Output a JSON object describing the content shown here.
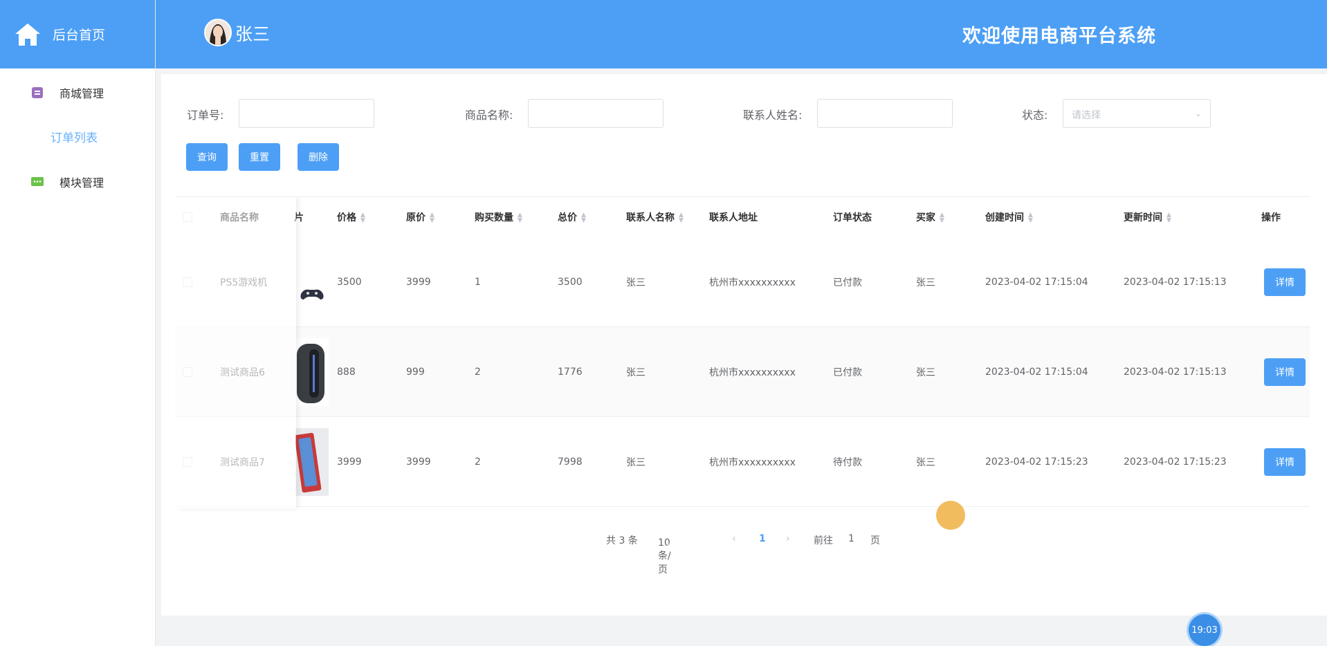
{
  "sidebar": {
    "brand_label": "后台首页",
    "groups": [
      {
        "label": "商城管理",
        "icon": "store-icon",
        "color": "#9b6fbf"
      },
      {
        "label": "模块管理",
        "icon": "message-icon",
        "color": "#6cc24a"
      }
    ],
    "submenu": [
      {
        "label": "订单列表"
      }
    ]
  },
  "header": {
    "username": "张三",
    "welcome": "欢迎使用电商平台系统"
  },
  "search": {
    "order_no_label": "订单号:",
    "product_name_label": "商品名称:",
    "contact_name_label": "联系人姓名:",
    "status_label": "状态:",
    "status_placeholder": "请选择"
  },
  "buttons": {
    "query": "查询",
    "reset": "重置",
    "delete": "删除",
    "detail": "详情"
  },
  "table": {
    "columns": {
      "name": "商品名称",
      "pic": "片",
      "price": "价格",
      "orig_price": "原价",
      "qty": "购买数量",
      "total": "总价",
      "contact_name": "联系人名称",
      "contact_addr": "联系人地址",
      "status": "订单状态",
      "buyer": "买家",
      "created": "创建时间",
      "updated": "更新时间",
      "op": "操作"
    },
    "rows": [
      {
        "name": "PS5游戏机",
        "price": "3500",
        "orig_price": "3999",
        "qty": "1",
        "total": "3500",
        "contact_name": "张三",
        "contact_addr": "杭州市xxxxxxxxxx",
        "status": "已付款",
        "buyer": "张三",
        "created": "2023-04-02 17:15:04",
        "updated": "2023-04-02 17:15:13"
      },
      {
        "name": "测试商品6",
        "price": "888",
        "orig_price": "999",
        "qty": "2",
        "total": "1776",
        "contact_name": "张三",
        "contact_addr": "杭州市xxxxxxxxxx",
        "status": "已付款",
        "buyer": "张三",
        "created": "2023-04-02 17:15:04",
        "updated": "2023-04-02 17:15:13"
      },
      {
        "name": "测试商品7",
        "price": "3999",
        "orig_price": "3999",
        "qty": "2",
        "total": "7998",
        "contact_name": "张三",
        "contact_addr": "杭州市xxxxxxxxxx",
        "status": "待付款",
        "buyer": "张三",
        "created": "2023-04-02 17:15:23",
        "updated": "2023-04-02 17:15:23"
      }
    ]
  },
  "pagination": {
    "total": "共 3 条",
    "page_size": "10条/页",
    "current": "1",
    "goto_label": "前往",
    "goto_value": "1",
    "page_suffix": "页"
  },
  "clock": "19:03",
  "colors": {
    "primary": "#4c9ff5",
    "header": "#4c9ff5"
  }
}
